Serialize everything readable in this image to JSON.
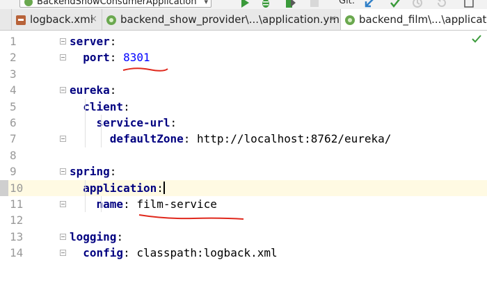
{
  "toolbar": {
    "run_config_label": "BackendShowConsumerApplication",
    "git_label": "Git:"
  },
  "tabs": [
    {
      "label": "logback.xml",
      "icon": "xml-file-icon",
      "close": "×"
    },
    {
      "label": "backend_show_provider\\...\\application.yml",
      "icon": "spring-leaf-icon",
      "close": "×"
    },
    {
      "label": "backend_film\\...\\application",
      "icon": "spring-leaf-icon",
      "active": true
    }
  ],
  "editor": {
    "lines": [
      {
        "n": "1",
        "key": "server",
        "sep": ":",
        "value": ""
      },
      {
        "n": "2",
        "key": "  port",
        "sep": ": ",
        "value": "8301"
      },
      {
        "n": "3",
        "key": "",
        "sep": "",
        "value": ""
      },
      {
        "n": "4",
        "key": "eureka",
        "sep": ":",
        "value": ""
      },
      {
        "n": "5",
        "key": "  client",
        "sep": ":",
        "value": ""
      },
      {
        "n": "6",
        "key": "    service-url",
        "sep": ":",
        "value": ""
      },
      {
        "n": "7",
        "key": "      defaultZone",
        "sep": ": ",
        "value": "http://localhost:8762/eureka/"
      },
      {
        "n": "8",
        "key": "",
        "sep": "",
        "value": ""
      },
      {
        "n": "9",
        "key": "spring",
        "sep": ":",
        "value": ""
      },
      {
        "n": "10",
        "key": "  application",
        "sep": ":",
        "value": ""
      },
      {
        "n": "11",
        "key": "    name",
        "sep": ": ",
        "value": "film-service"
      },
      {
        "n": "12",
        "key": "",
        "sep": "",
        "value": ""
      },
      {
        "n": "13",
        "key": "logging",
        "sep": ":",
        "value": ""
      },
      {
        "n": "14",
        "key": "  config",
        "sep": ": ",
        "value": "classpath:logback.xml"
      }
    ],
    "caret_line": "10"
  },
  "colors": {
    "key": "#000080",
    "number": "#0000ff",
    "underline": "#e0281c",
    "caret_line_bg": "#fffae3"
  }
}
